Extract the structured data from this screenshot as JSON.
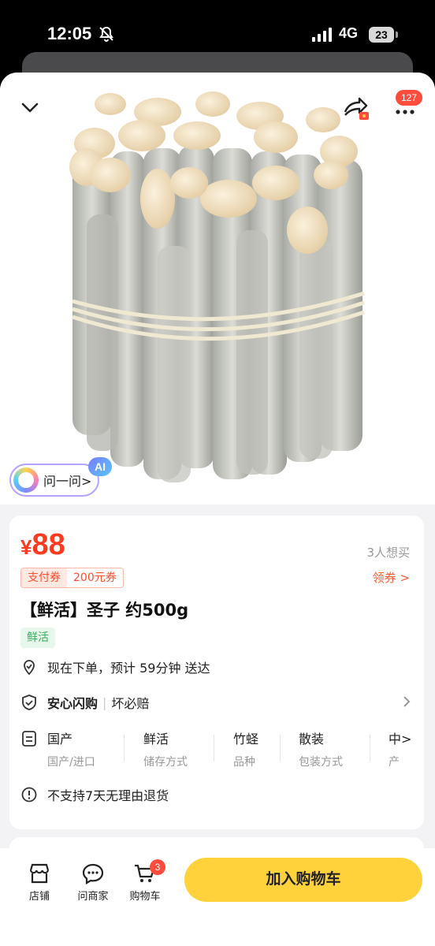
{
  "status_bar": {
    "time": "12:05",
    "network": "4G",
    "battery": "23"
  },
  "header": {
    "message_badge": "127"
  },
  "ai_assistant": {
    "label": "问一问>",
    "tag": "AI"
  },
  "product": {
    "price_currency": "¥",
    "price": "88",
    "want_count": "3人想买",
    "coupon_label": "支付券",
    "coupon_value": "200元券",
    "claim_coupon": "领券 >",
    "title": "【鲜活】圣子 约500g",
    "tag": "鲜活",
    "delivery": "现在下单，预计 59分钟 送达",
    "assurance_title": "安心闪购",
    "assurance_desc": "坏必赔",
    "attributes": [
      {
        "value": "国产",
        "key": "国产/进口"
      },
      {
        "value": "鲜活",
        "key": "储存方式"
      },
      {
        "value": "竹蛏",
        "key": "品种"
      },
      {
        "value": "散装",
        "key": "包装方式"
      },
      {
        "value": "中>",
        "key": "产"
      }
    ],
    "return_policy": "不支持7天无理由退货"
  },
  "bottom_bar": {
    "store": "店铺",
    "ask_merchant": "问商家",
    "cart": "购物车",
    "cart_count": "3",
    "add_to_cart": "加入购物车"
  },
  "colors": {
    "price": "#ff3b1f",
    "button": "#ffd23c",
    "badge": "#ff4d3d",
    "fresh": "#2fb25a"
  },
  "icons": [
    "bell-muted-icon",
    "signal-icon",
    "chevron-down-icon",
    "share-icon",
    "more-icon",
    "delivery-icon",
    "shield-check-icon",
    "list-icon",
    "info-icon",
    "store-icon",
    "chat-icon",
    "cart-icon"
  ]
}
